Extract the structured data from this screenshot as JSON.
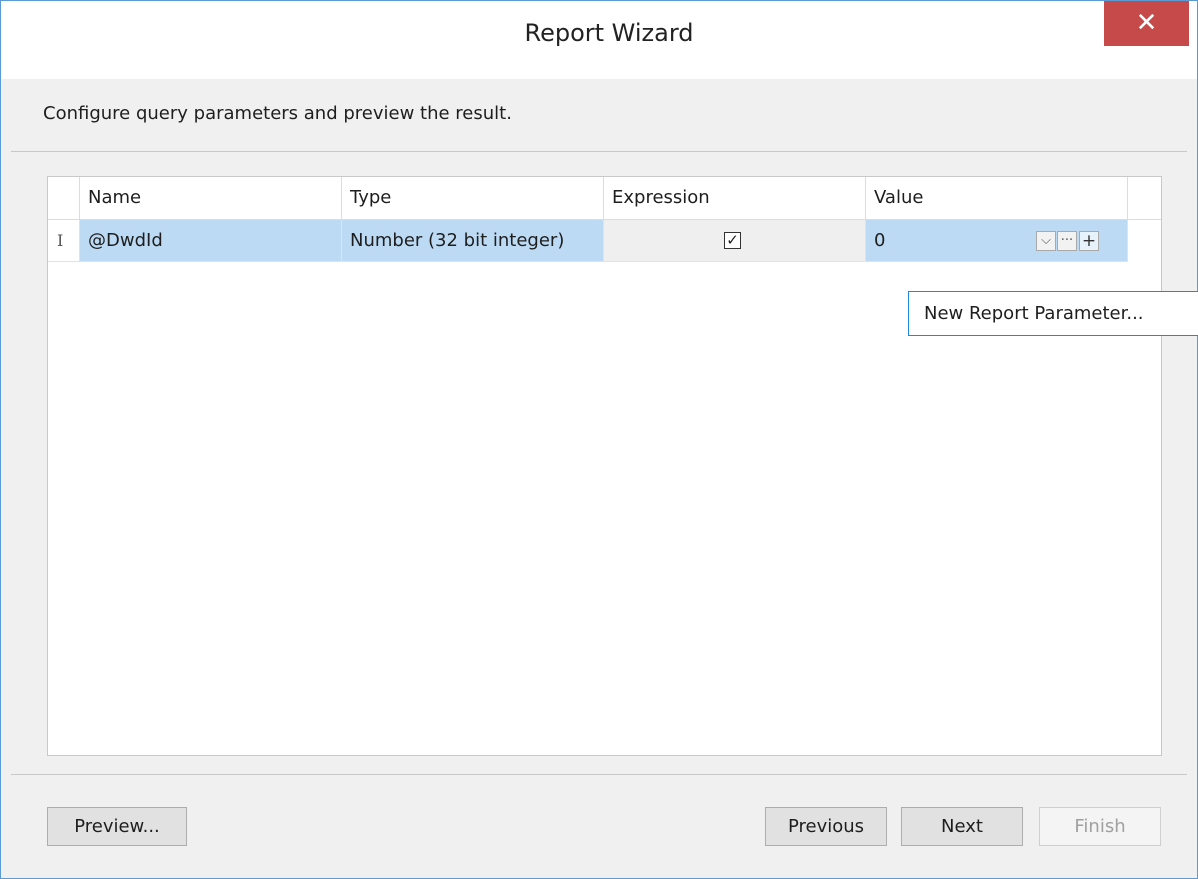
{
  "window": {
    "title": "Report Wizard",
    "close_icon": "close-icon",
    "close_symbol": "✕"
  },
  "subtitle": "Configure query parameters and preview the result.",
  "grid": {
    "columns": [
      "Name",
      "Type",
      "Expression",
      "Value"
    ],
    "rows": [
      {
        "indicator": "I",
        "name": "@DwdId",
        "type": "Number (32 bit integer)",
        "expression_checked": true,
        "value": "0"
      }
    ]
  },
  "value_buttons": {
    "dropdown": "⌵",
    "ellipsis": "···",
    "add": "+"
  },
  "tooltip": "New Report Parameter...",
  "buttons": {
    "preview": "Preview...",
    "previous": "Previous",
    "next": "Next",
    "finish": "Finish"
  },
  "colors": {
    "selection": "#bcdaf4",
    "close": "#c74a4a",
    "tooltip_border": "#1e88e5"
  }
}
